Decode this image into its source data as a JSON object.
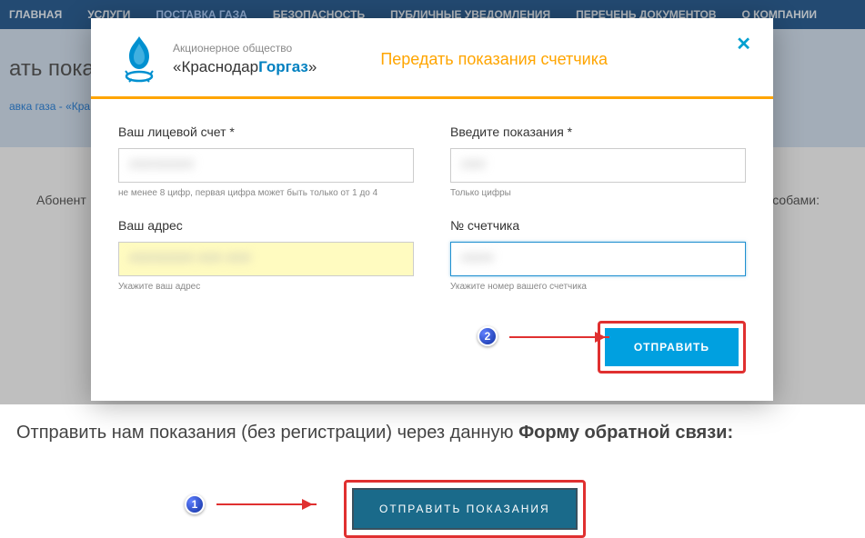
{
  "nav": {
    "items": [
      "ГЛАВНАЯ",
      "УСЛУГИ",
      "ПОСТАВКА ГАЗА",
      "БЕЗОПАСНОСТЬ",
      "ПУБЛИЧНЫЕ УВЕДОМЛЕНИЯ",
      "ПЕРЕЧЕНЬ ДОКУМЕНТОВ",
      "О КОМПАНИИ"
    ]
  },
  "header": {
    "title_fragment": "ать пока",
    "breadcrumb": "авка газа - «Кра"
  },
  "content": {
    "abonent_prefix": "Абонент",
    "abonent_suffix": "собами:",
    "instruction_part1": "Отправить нам показания (без регистрации) через данную ",
    "instruction_part2": "Форму обратной связи:",
    "send_button": "ОТПРАВИТЬ ПОКАЗАНИЯ"
  },
  "modal": {
    "company_sub": "Акционерное общество",
    "company_name_part1": "«Краснодар",
    "company_name_part2": "Горгаз",
    "company_name_part3": "»",
    "title": "Передать показания счетчика",
    "close": "✕",
    "form": {
      "account_label": "Ваш лицевой счет *",
      "account_hint": "не менее 8 цифр, первая цифра может быть только от 1 до 4",
      "reading_label": "Введите показания *",
      "reading_hint": "Только цифры",
      "address_label": "Ваш адрес",
      "address_hint": "Укажите ваш адрес",
      "meter_label": "№ счетчика",
      "meter_hint": "Укажите номер вашего счетчика"
    },
    "submit_button": "ОТПРАВИТЬ"
  },
  "badges": {
    "one": "1",
    "two": "2"
  }
}
